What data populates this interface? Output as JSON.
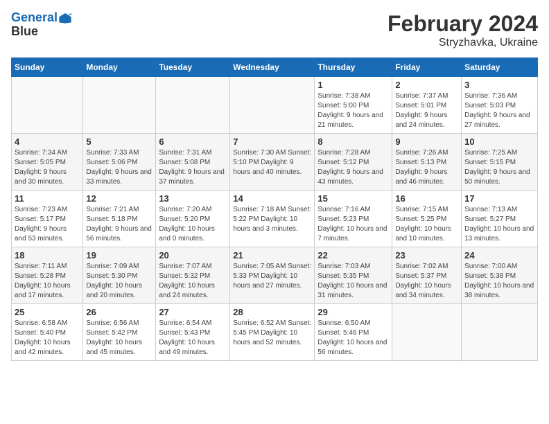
{
  "header": {
    "logo_line1": "General",
    "logo_line2": "Blue",
    "main_title": "February 2024",
    "subtitle": "Stryzhavka, Ukraine"
  },
  "days_of_week": [
    "Sunday",
    "Monday",
    "Tuesday",
    "Wednesday",
    "Thursday",
    "Friday",
    "Saturday"
  ],
  "weeks": [
    {
      "cells": [
        {
          "day": "",
          "info": "",
          "empty": true
        },
        {
          "day": "",
          "info": "",
          "empty": true
        },
        {
          "day": "",
          "info": "",
          "empty": true
        },
        {
          "day": "",
          "info": "",
          "empty": true
        },
        {
          "day": "1",
          "info": "Sunrise: 7:38 AM\nSunset: 5:00 PM\nDaylight: 9 hours\nand 21 minutes.",
          "empty": false
        },
        {
          "day": "2",
          "info": "Sunrise: 7:37 AM\nSunset: 5:01 PM\nDaylight: 9 hours\nand 24 minutes.",
          "empty": false
        },
        {
          "day": "3",
          "info": "Sunrise: 7:36 AM\nSunset: 5:03 PM\nDaylight: 9 hours\nand 27 minutes.",
          "empty": false
        }
      ]
    },
    {
      "cells": [
        {
          "day": "4",
          "info": "Sunrise: 7:34 AM\nSunset: 5:05 PM\nDaylight: 9 hours\nand 30 minutes.",
          "empty": false
        },
        {
          "day": "5",
          "info": "Sunrise: 7:33 AM\nSunset: 5:06 PM\nDaylight: 9 hours\nand 33 minutes.",
          "empty": false
        },
        {
          "day": "6",
          "info": "Sunrise: 7:31 AM\nSunset: 5:08 PM\nDaylight: 9 hours\nand 37 minutes.",
          "empty": false
        },
        {
          "day": "7",
          "info": "Sunrise: 7:30 AM\nSunset: 5:10 PM\nDaylight: 9 hours\nand 40 minutes.",
          "empty": false
        },
        {
          "day": "8",
          "info": "Sunrise: 7:28 AM\nSunset: 5:12 PM\nDaylight: 9 hours\nand 43 minutes.",
          "empty": false
        },
        {
          "day": "9",
          "info": "Sunrise: 7:26 AM\nSunset: 5:13 PM\nDaylight: 9 hours\nand 46 minutes.",
          "empty": false
        },
        {
          "day": "10",
          "info": "Sunrise: 7:25 AM\nSunset: 5:15 PM\nDaylight: 9 hours\nand 50 minutes.",
          "empty": false
        }
      ]
    },
    {
      "cells": [
        {
          "day": "11",
          "info": "Sunrise: 7:23 AM\nSunset: 5:17 PM\nDaylight: 9 hours\nand 53 minutes.",
          "empty": false
        },
        {
          "day": "12",
          "info": "Sunrise: 7:21 AM\nSunset: 5:18 PM\nDaylight: 9 hours\nand 56 minutes.",
          "empty": false
        },
        {
          "day": "13",
          "info": "Sunrise: 7:20 AM\nSunset: 5:20 PM\nDaylight: 10 hours\nand 0 minutes.",
          "empty": false
        },
        {
          "day": "14",
          "info": "Sunrise: 7:18 AM\nSunset: 5:22 PM\nDaylight: 10 hours\nand 3 minutes.",
          "empty": false
        },
        {
          "day": "15",
          "info": "Sunrise: 7:16 AM\nSunset: 5:23 PM\nDaylight: 10 hours\nand 7 minutes.",
          "empty": false
        },
        {
          "day": "16",
          "info": "Sunrise: 7:15 AM\nSunset: 5:25 PM\nDaylight: 10 hours\nand 10 minutes.",
          "empty": false
        },
        {
          "day": "17",
          "info": "Sunrise: 7:13 AM\nSunset: 5:27 PM\nDaylight: 10 hours\nand 13 minutes.",
          "empty": false
        }
      ]
    },
    {
      "cells": [
        {
          "day": "18",
          "info": "Sunrise: 7:11 AM\nSunset: 5:28 PM\nDaylight: 10 hours\nand 17 minutes.",
          "empty": false
        },
        {
          "day": "19",
          "info": "Sunrise: 7:09 AM\nSunset: 5:30 PM\nDaylight: 10 hours\nand 20 minutes.",
          "empty": false
        },
        {
          "day": "20",
          "info": "Sunrise: 7:07 AM\nSunset: 5:32 PM\nDaylight: 10 hours\nand 24 minutes.",
          "empty": false
        },
        {
          "day": "21",
          "info": "Sunrise: 7:05 AM\nSunset: 5:33 PM\nDaylight: 10 hours\nand 27 minutes.",
          "empty": false
        },
        {
          "day": "22",
          "info": "Sunrise: 7:03 AM\nSunset: 5:35 PM\nDaylight: 10 hours\nand 31 minutes.",
          "empty": false
        },
        {
          "day": "23",
          "info": "Sunrise: 7:02 AM\nSunset: 5:37 PM\nDaylight: 10 hours\nand 34 minutes.",
          "empty": false
        },
        {
          "day": "24",
          "info": "Sunrise: 7:00 AM\nSunset: 5:38 PM\nDaylight: 10 hours\nand 38 minutes.",
          "empty": false
        }
      ]
    },
    {
      "cells": [
        {
          "day": "25",
          "info": "Sunrise: 6:58 AM\nSunset: 5:40 PM\nDaylight: 10 hours\nand 42 minutes.",
          "empty": false
        },
        {
          "day": "26",
          "info": "Sunrise: 6:56 AM\nSunset: 5:42 PM\nDaylight: 10 hours\nand 45 minutes.",
          "empty": false
        },
        {
          "day": "27",
          "info": "Sunrise: 6:54 AM\nSunset: 5:43 PM\nDaylight: 10 hours\nand 49 minutes.",
          "empty": false
        },
        {
          "day": "28",
          "info": "Sunrise: 6:52 AM\nSunset: 5:45 PM\nDaylight: 10 hours\nand 52 minutes.",
          "empty": false
        },
        {
          "day": "29",
          "info": "Sunrise: 6:50 AM\nSunset: 5:46 PM\nDaylight: 10 hours\nand 56 minutes.",
          "empty": false
        },
        {
          "day": "",
          "info": "",
          "empty": true
        },
        {
          "day": "",
          "info": "",
          "empty": true
        }
      ]
    }
  ]
}
